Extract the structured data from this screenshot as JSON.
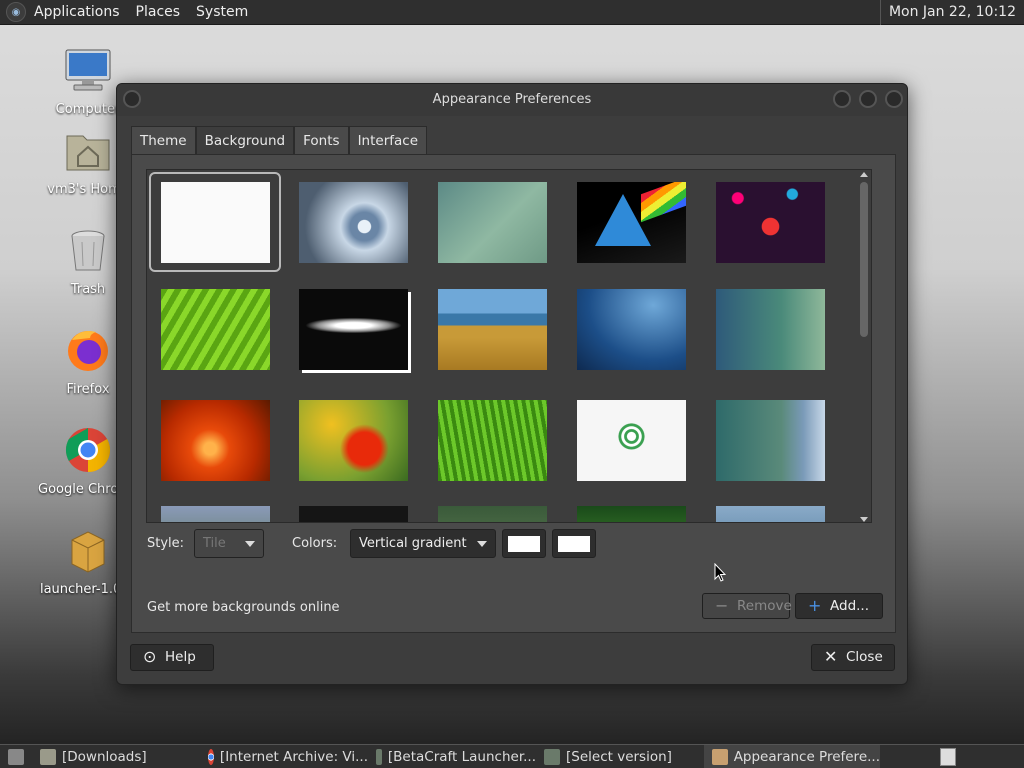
{
  "top_panel": {
    "menus": [
      "Applications",
      "Places",
      "System"
    ],
    "clock": "Mon Jan 22, 10:12"
  },
  "desktop_icons": [
    {
      "label": "Computer"
    },
    {
      "label": "vm3's Home"
    },
    {
      "label": "Trash"
    },
    {
      "label": "Firefox"
    },
    {
      "label": "Google Chrome"
    },
    {
      "label": "launcher-1.09_"
    }
  ],
  "window": {
    "title": "Appearance Preferences",
    "tabs": [
      "Theme",
      "Background",
      "Fonts",
      "Interface"
    ],
    "active_tab": "Background",
    "style_label": "Style:",
    "style_value": "Tile",
    "colors_label": "Colors:",
    "colors_value": "Vertical gradient",
    "online_link": "Get more backgrounds online",
    "remove_label": "Remove",
    "add_label": "Add...",
    "help_label": "Help",
    "close_label": "Close"
  },
  "taskbar": {
    "items": [
      "[Downloads]",
      "[Internet Archive: Vi...",
      "[BetaCraft Launcher...",
      "[Select version]",
      "Appearance Prefere..."
    ]
  }
}
